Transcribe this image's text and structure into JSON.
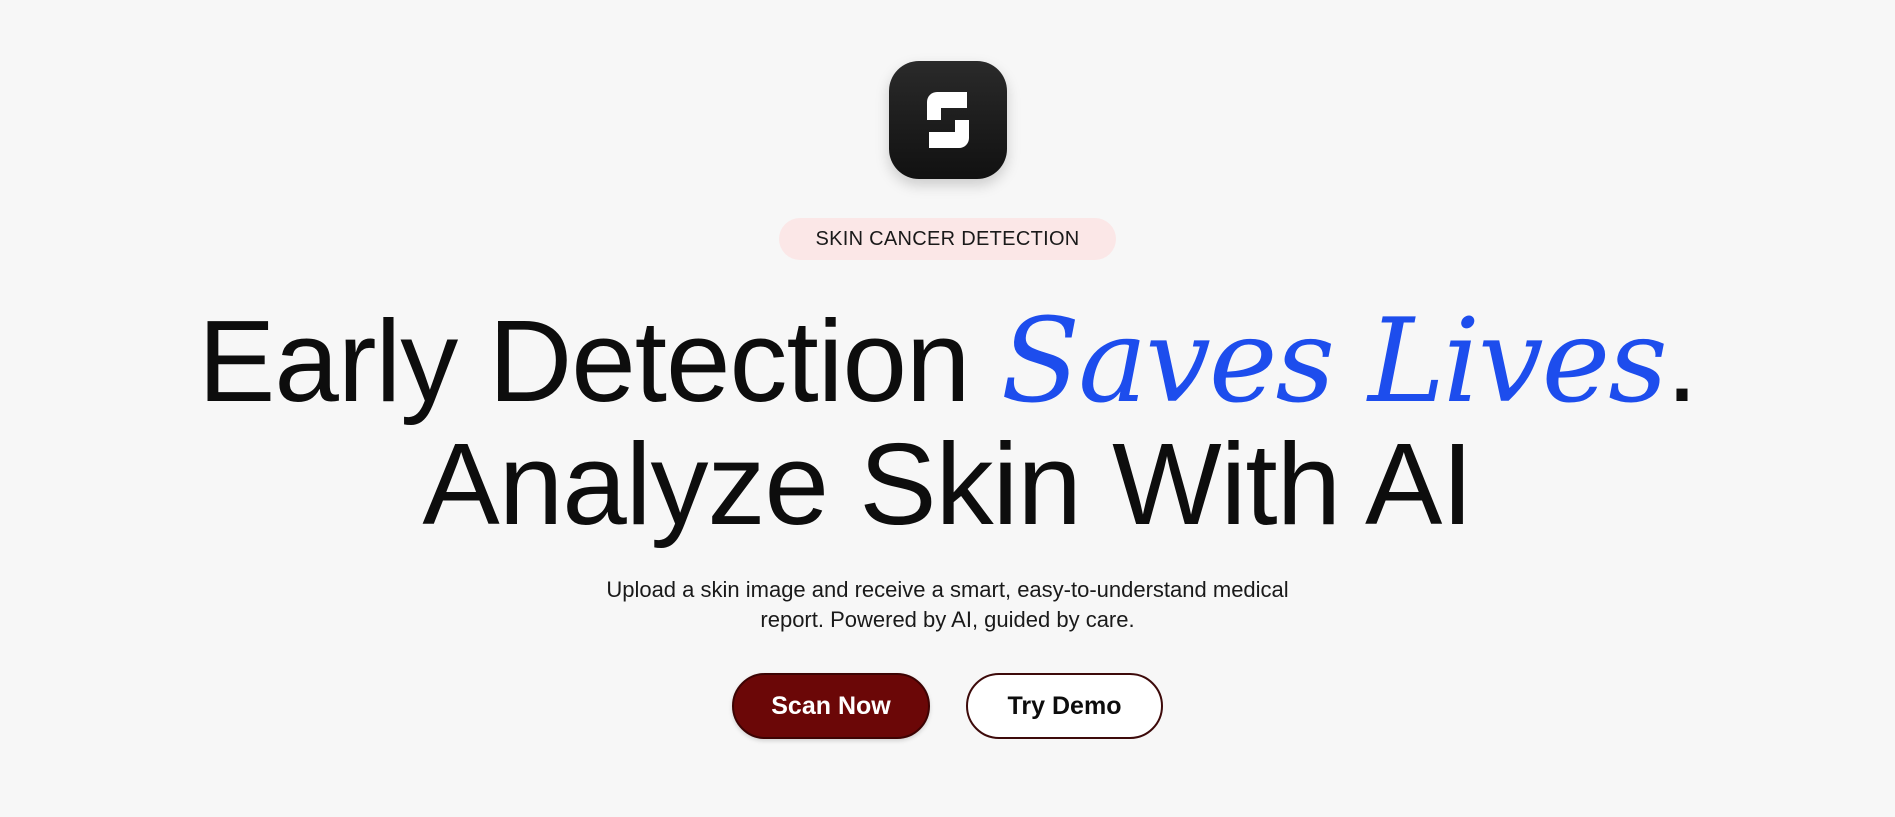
{
  "logo": {
    "icon": "s-logo-icon",
    "background": "#111111"
  },
  "badge": {
    "text": "SKIN CANCER DETECTION",
    "background": "#fbe7e7"
  },
  "headline": {
    "line1_prefix": "Early Detection ",
    "line1_accent": "Saves Lives",
    "line1_suffix": ".",
    "line2": "Analyze Skin With AI",
    "accent_color": "#1d4ded"
  },
  "subtitle": {
    "line1": "Upload a skin image and receive a smart, easy-to-understand medical",
    "line2": "report. Powered by AI, guided by care."
  },
  "actions": {
    "primary_label": "Scan Now",
    "primary_color": "#6b0707",
    "secondary_label": "Try Demo"
  }
}
